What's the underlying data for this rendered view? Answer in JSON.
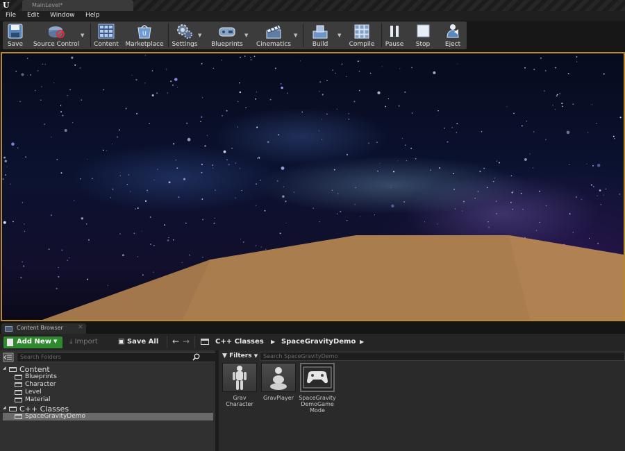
{
  "titlebar": {
    "tab_title": "MainLevel*"
  },
  "menu": [
    "File",
    "Edit",
    "Window",
    "Help"
  ],
  "toolbar": {
    "buttons": [
      {
        "label": "Save",
        "icon": "save-icon"
      },
      {
        "label": "Source Control",
        "icon": "source-control-icon"
      },
      {
        "label": "Content",
        "icon": "content-icon"
      },
      {
        "label": "Marketplace",
        "icon": "marketplace-icon"
      },
      {
        "label": "Settings",
        "icon": "settings-icon"
      },
      {
        "label": "Blueprints",
        "icon": "blueprints-icon"
      },
      {
        "label": "Cinematics",
        "icon": "cinematics-icon"
      },
      {
        "label": "Build",
        "icon": "build-icon"
      },
      {
        "label": "Compile",
        "icon": "compile-icon"
      },
      {
        "label": "Pause",
        "icon": "pause-icon"
      },
      {
        "label": "Stop",
        "icon": "stop-icon"
      },
      {
        "label": "Eject",
        "icon": "eject-icon"
      }
    ]
  },
  "content_browser": {
    "tab_label": "Content Browser",
    "add_new_label": "Add New",
    "import_label": "Import",
    "save_all_label": "Save All",
    "breadcrumbs": [
      "C++ Classes",
      "SpaceGravityDemo"
    ],
    "folder_search_placeholder": "Search Folders",
    "asset_search_placeholder": "Search SpaceGravityDemo",
    "filters_label": "Filters",
    "tree": {
      "content_label": "Content",
      "content_children": [
        "Blueprints",
        "Character",
        "Level",
        "Material"
      ],
      "cpp_label": "C++ Classes",
      "cpp_children": [
        "SpaceGravityDemo"
      ]
    },
    "assets": [
      {
        "name": "Grav\nCharacter",
        "icon": "character-mannequin-icon"
      },
      {
        "name": "GravPlayer",
        "icon": "pawn-icon"
      },
      {
        "name": "SpaceGravity\nDemoGame\nMode",
        "icon": "gamepad-icon"
      }
    ]
  },
  "colors": {
    "viewport_border": "#b88a2a",
    "add_new_bg": "#2f8a2f",
    "ground": "#a97d4e",
    "space": "#0b1230"
  }
}
